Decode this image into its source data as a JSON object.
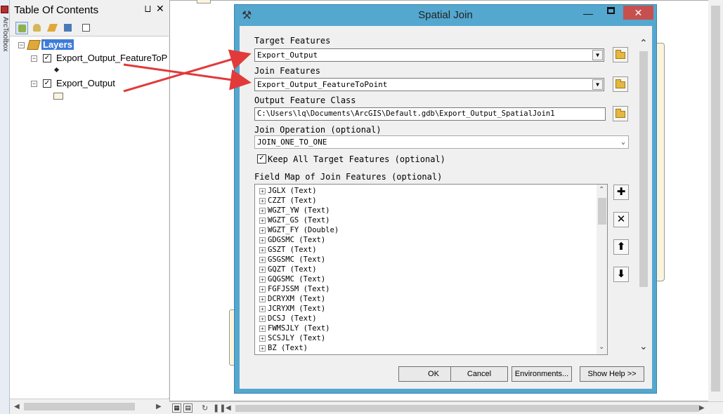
{
  "toolbox": {
    "label": "ArcToolbox"
  },
  "toc": {
    "title": "Table Of Contents",
    "pin_glyph": "⨆",
    "close_glyph": "✕",
    "layers_label": "Layers",
    "layer1_name": "Export_Output_FeatureToP",
    "layer1_visible": true,
    "layer2_name": "Export_Output",
    "layer2_visible": true
  },
  "dialog": {
    "title": "Spatial Join",
    "target_features_label": "Target Features",
    "target_features_value": "Export_Output",
    "join_features_label": "Join Features",
    "join_features_value": "Export_Output_FeatureToPoint",
    "output_label": "Output Feature Class",
    "output_value": "C:\\Users\\lq\\Documents\\ArcGIS\\Default.gdb\\Export_Output_SpatialJoin1",
    "join_operation_label": "Join Operation (optional)",
    "join_operation_value": "JOIN_ONE_TO_ONE",
    "keep_all_label": "Keep All Target Features (optional)",
    "keep_all_checked": true,
    "field_map_label": "Field Map of Join Features (optional)",
    "fields": [
      "JGLX (Text)",
      "CZZT (Text)",
      "WGZT_YW (Text)",
      "WGZT_GS (Text)",
      "WGZT_FY (Double)",
      "GDGSMC (Text)",
      "GSZT (Text)",
      "GSGSMC (Text)",
      "GQZT (Text)",
      "GQGSMC (Text)",
      "FGFJSSM (Text)",
      "DCRYXM (Text)",
      "JCRYXM (Text)",
      "DCSJ (Text)",
      "FWMSJLY (Text)",
      "SCSJLY (Text)",
      "BZ (Text)"
    ],
    "buttons": {
      "ok": "OK",
      "cancel": "Cancel",
      "environments": "Environments...",
      "show_help": "Show Help >>"
    }
  },
  "colors": {
    "dialog_frame": "#54a7cf",
    "close_button": "#c7504f",
    "selected_layer": "#3d7bd9",
    "annotation_arrow": "#e23a3a",
    "map_polygon_fill": "#fbf4dc"
  }
}
